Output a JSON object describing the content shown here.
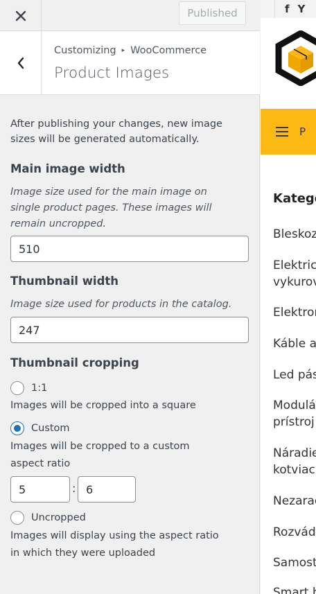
{
  "topbar": {
    "close_icon": "close-icon",
    "publish_label": "Published"
  },
  "section": {
    "breadcrumb_parent": "Customizing",
    "breadcrumb_child": "WooCommerce",
    "title": "Product Images"
  },
  "intro": "After publishing your changes, new image sizes will be generated automatically.",
  "main_image": {
    "label": "Main image width",
    "description": "Image size used for the main image on single product pages. These images will remain uncropped.",
    "value": "510"
  },
  "thumbnail": {
    "label": "Thumbnail width",
    "description": "Image size used for products in the catalog.",
    "value": "247"
  },
  "cropping": {
    "label": "Thumbnail cropping",
    "options": [
      {
        "label": "1:1",
        "note": "Images will be cropped into a square",
        "checked": false
      },
      {
        "label": "Custom",
        "note_line1": "Images will be cropped to a custom",
        "note_line2": "aspect ratio",
        "checked": true
      },
      {
        "label": "Uncropped",
        "note_line1": "Images will display using the aspect ratio",
        "note_line2": "in which they were uploaded",
        "checked": false
      }
    ],
    "ratio_width": "5",
    "ratio_sep": ":",
    "ratio_height": "6"
  },
  "preview": {
    "social": [
      "f",
      "Y"
    ],
    "menu_text": "P",
    "categories_title": "Kategó",
    "categories": [
      "Bleskoz",
      "Elektrick",
      "vykurov",
      "Elektron",
      "Káble a",
      "Led pás",
      "Modulá",
      "prístroj",
      "Náradie",
      "kotviaci",
      "Nezarad",
      "Rozvádz",
      "Samosta",
      "Smart h"
    ],
    "colors": {
      "menu_bar": "#fdb913",
      "accent": "#2271b1"
    }
  }
}
